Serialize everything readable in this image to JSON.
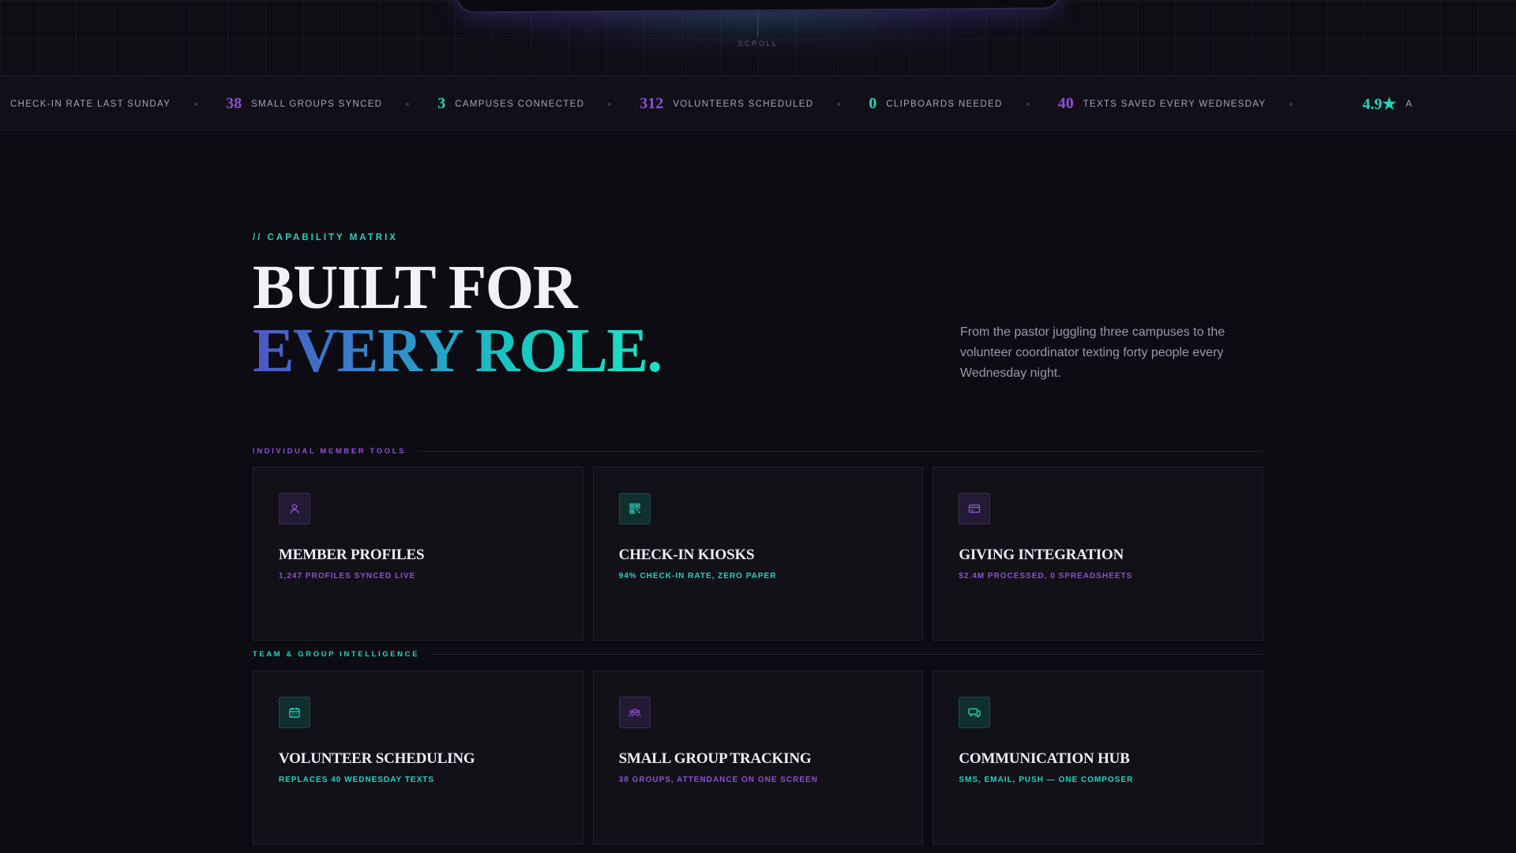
{
  "hero": {
    "scroll_label": "SCROLL"
  },
  "ticker": [
    {
      "num": "",
      "label": "CHECK-IN RATE LAST SUNDAY",
      "color": "#8e4fd6"
    },
    {
      "num": "38",
      "label": "SMALL GROUPS SYNCED",
      "color": "#8e4fd6"
    },
    {
      "num": "3",
      "label": "CAMPUSES CONNECTED",
      "color": "#1fd6c0"
    },
    {
      "num": "312",
      "label": "VOLUNTEERS SCHEDULED",
      "color": "#8e4fd6"
    },
    {
      "num": "0",
      "label": "CLIPBOARDS NEEDED",
      "color": "#1fd6c0"
    },
    {
      "num": "40",
      "label": "TEXTS SAVED EVERY WEDNESDAY",
      "color": "#8e4fd6"
    },
    {
      "num": "4.9★",
      "label": "A",
      "color": "#1fd6c0"
    }
  ],
  "section": {
    "eyebrow": "// CAPABILITY MATRIX",
    "headline_line1": "BUILT FOR",
    "headline_line2": "EVERY ROLE.",
    "lede": "From the pastor juggling three campuses to the volunteer coordinator texting forty people every Wednesday night."
  },
  "groups": [
    {
      "label": "INDIVIDUAL MEMBER TOOLS",
      "color": "#8e4fd6",
      "cards": [
        {
          "icon": "user-icon",
          "tone": "purple",
          "title": "MEMBER PROFILES",
          "sub": "1,247 PROFILES SYNCED LIVE"
        },
        {
          "icon": "qr-code-icon",
          "tone": "teal",
          "title": "CHECK-IN KIOSKS",
          "sub": "94% CHECK-IN RATE, ZERO PAPER"
        },
        {
          "icon": "credit-card-icon",
          "tone": "purple",
          "title": "GIVING INTEGRATION",
          "sub": "$2.4M PROCESSED, 0 SPREADSHEETS"
        }
      ]
    },
    {
      "label": "TEAM & GROUP INTELLIGENCE",
      "color": "#1fd6c0",
      "cards": [
        {
          "icon": "calendar-icon",
          "tone": "teal",
          "title": "VOLUNTEER SCHEDULING",
          "sub": "REPLACES 40 WEDNESDAY TEXTS"
        },
        {
          "icon": "group-icon",
          "tone": "purple",
          "title": "SMALL GROUP TRACKING",
          "sub": "38 GROUPS, ATTENDANCE ON ONE SCREEN"
        },
        {
          "icon": "chat-bubbles-icon",
          "tone": "teal",
          "title": "COMMUNICATION HUB",
          "sub": "SMS, EMAIL, PUSH — ONE COMPOSER"
        }
      ]
    }
  ]
}
